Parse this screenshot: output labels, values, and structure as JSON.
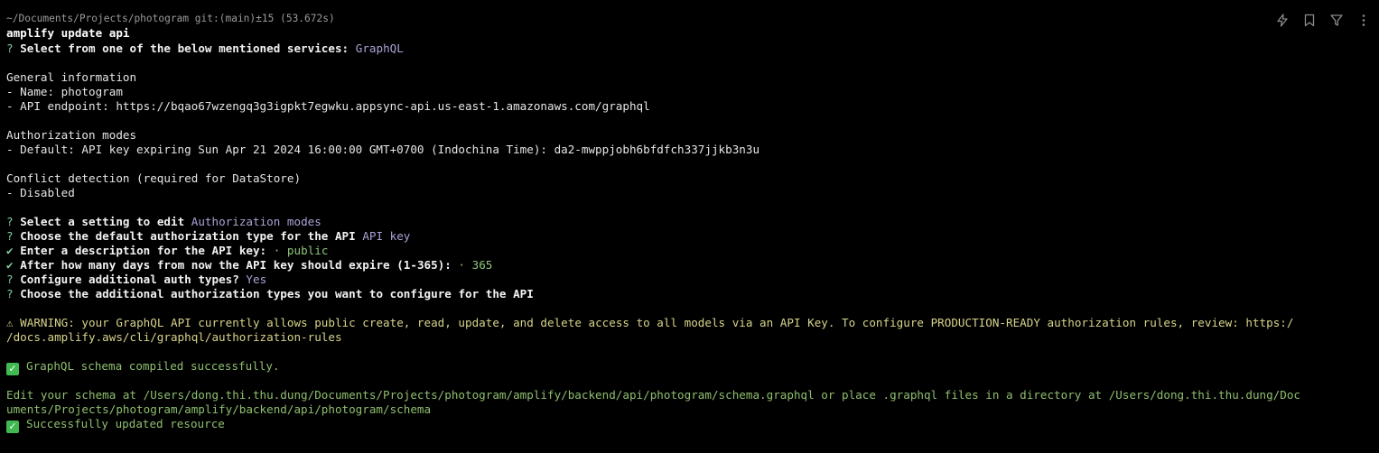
{
  "prompt": {
    "path_info": "~/Documents/Projects/photogram git:(main)±15 (53.672s)",
    "command": "amplify update api"
  },
  "toolbar": {
    "icons": [
      "lightning-icon",
      "bookmark-icon",
      "filter-icon",
      "more-icon"
    ]
  },
  "output": {
    "select_service": {
      "mark": "?",
      "question": "Select from one of the below mentioned services:",
      "answer": "GraphQL"
    },
    "general_info": {
      "heading": "General information",
      "name": "- Name: photogram",
      "endpoint": "- API endpoint: https://bqao67wzengq3g3igpkt7egwku.appsync-api.us-east-1.amazonaws.com/graphql"
    },
    "auth_modes": {
      "heading": "Authorization modes",
      "default": "- Default: API key expiring Sun Apr 21 2024 16:00:00 GMT+0700 (Indochina Time): da2-mwppjobh6bfdfch337jjkb3n3u"
    },
    "conflict": {
      "heading": "Conflict detection (required for DataStore)",
      "value": "- Disabled"
    },
    "prompts": [
      {
        "mark": "?",
        "question": "Select a setting to edit",
        "answer": "Authorization modes"
      },
      {
        "mark": "?",
        "question": "Choose the default authorization type for the API",
        "answer": "API key"
      },
      {
        "mark": "✔",
        "question": "Enter a description for the API key:",
        "answer": "· public"
      },
      {
        "mark": "✔",
        "question": "After how many days from now the API key should expire (1-365):",
        "answer": "· 365"
      },
      {
        "mark": "?",
        "question": "Configure additional auth types?",
        "answer": "Yes"
      },
      {
        "mark": "?",
        "question": "Choose the additional authorization types you want to configure for the API",
        "answer": ""
      }
    ],
    "warning": {
      "icon": "⚠",
      "line1": " WARNING: your GraphQL API currently allows public create, read, update, and delete access to all models via an API Key. To configure PRODUCTION-READY authorization rules, review: https:/",
      "line2": "/docs.amplify.aws/cli/graphql/authorization-rules"
    },
    "compiled": "GraphQL schema compiled successfully.",
    "edit_schema": {
      "line1": "Edit your schema at /Users/dong.thi.thu.dung/Documents/Projects/photogram/amplify/backend/api/photogram/schema.graphql or place .graphql files in a directory at /Users/dong.thi.thu.dung/Doc",
      "line2": "uments/Projects/photogram/amplify/backend/api/photogram/schema"
    },
    "updated": "Successfully updated resource",
    "check_emoji": "✓"
  }
}
